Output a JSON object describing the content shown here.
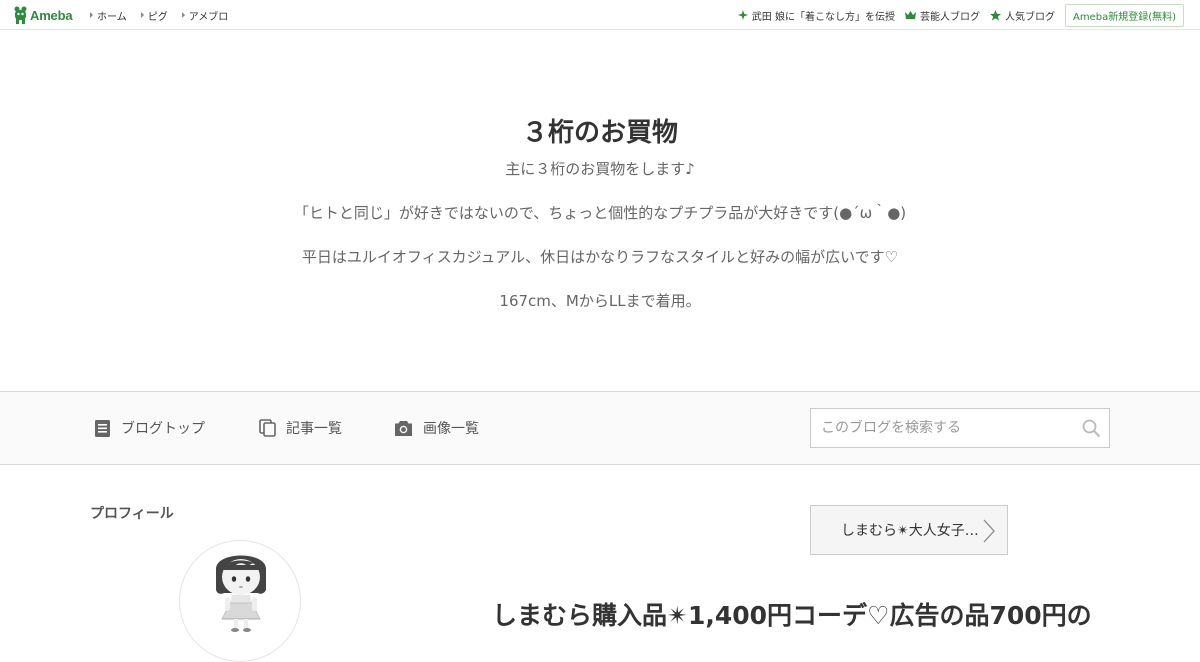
{
  "topbar": {
    "logo_text": "Ameba",
    "nav": [
      "ホーム",
      "ピグ",
      "アメブロ"
    ],
    "links": [
      {
        "icon": "sparkle-icon",
        "label": "武田 娘に「着こなし方」を伝授"
      },
      {
        "icon": "crown-icon",
        "label": "芸能人ブログ"
      },
      {
        "icon": "star-icon",
        "label": "人気ブログ"
      }
    ],
    "register_label": "Ameba新規登録(無料)"
  },
  "header": {
    "title": "３桁のお買物",
    "desc_lines": [
      "主に３桁のお買物をします♪",
      "「ヒトと同じ」が好きではないので、ちょっと個性的なプチプラ品が大好きです(●´ω｀●)",
      "平日はユルイオフィスカジュアル、休日はかなりラフなスタイルと好みの幅が広いです♡",
      "167cm、MからLLまで着用。"
    ]
  },
  "nav": {
    "blog_top": "ブログトップ",
    "articles": "記事一覧",
    "images": "画像一覧",
    "search_placeholder": "このブログを検索する"
  },
  "content": {
    "profile_heading": "プロフィール",
    "category_label": "しまむら✴大人女子…",
    "entry_title": "しまむら購入品✴1,400円コーデ♡広告の品700円の"
  },
  "colors": {
    "brand_green": "#2d8c3c",
    "text": "#333333",
    "muted": "#666666"
  }
}
